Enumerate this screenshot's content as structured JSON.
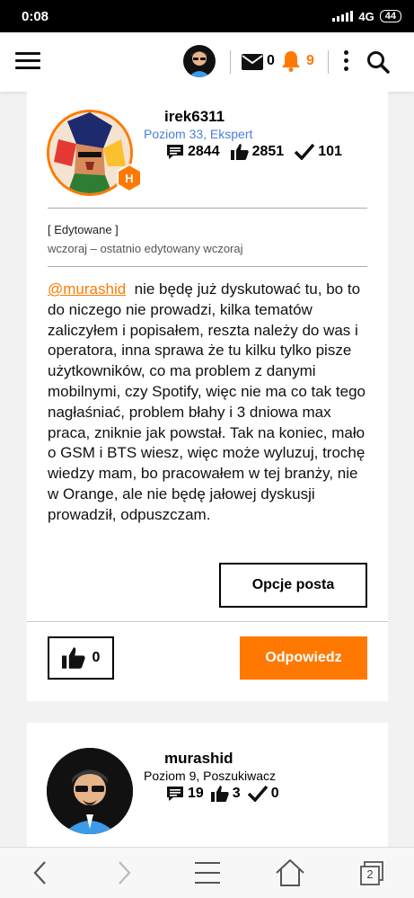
{
  "status_bar": {
    "time": "0:08",
    "network": "4G",
    "battery": "44"
  },
  "header": {
    "mail_count": "0",
    "notification_count": "9"
  },
  "post1": {
    "author": "irek6311",
    "level": "Poziom 33, Ekspert",
    "badge_letter": "H",
    "messages": "2844",
    "kudos": "2851",
    "solutions": "101",
    "edited_label": "[ Edytowane ]",
    "edited_meta": "wczoraj – ostatnio edytowany wczoraj",
    "mention": "@murashid",
    "body": "nie będę już dyskutować tu, bo to do niczego nie prowadzi, kilka tematów zaliczyłem i popisałem, reszta należy do was i operatora, inna sprawa że tu kilku tylko pisze użytkowników, co ma problem z danymi mobilnymi, czy Spotify, więc nie ma co tak tego nagłaśniać, problem błahy i 3 dniowa max praca, zniknie jak powstał. Tak na koniec, mało o GSM i BTS wiesz, więc może wyluzuj, trochę wiedzy mam, bo pracowałem w tej branży, nie w Orange, ale nie będę jałowej dyskusji prowadził, odpuszczam.",
    "options_label": "Opcje posta",
    "like_count": "0",
    "reply_label": "Odpowiedz"
  },
  "post2": {
    "author": "murashid",
    "level": "Poziom 9, Poszukiwacz",
    "messages": "19",
    "kudos": "3",
    "solutions": "0"
  },
  "browser_nav": {
    "tab_count": "2"
  },
  "colors": {
    "accent": "#ff7900",
    "level_blue": "#4a7fd6"
  }
}
